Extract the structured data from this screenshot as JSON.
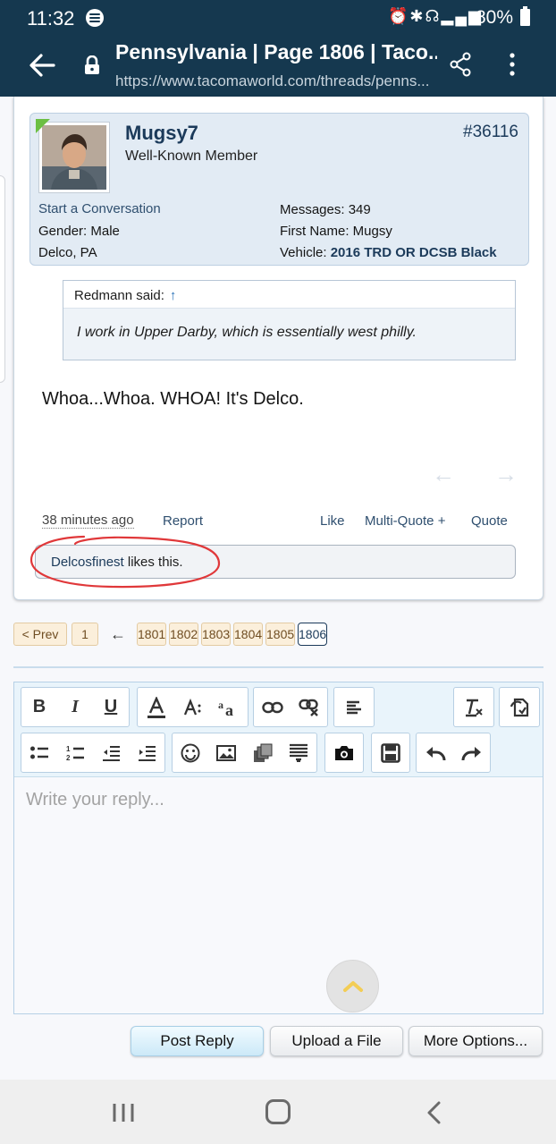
{
  "status_bar": {
    "time": "11:32",
    "battery": "80%"
  },
  "browser": {
    "title": "Pennsylvania | Page 1806 | Taco...",
    "url": "https://www.tacomaworld.com/threads/penns..."
  },
  "post": {
    "username": "Mugsy7",
    "user_title": "Well-Known Member",
    "post_number": "#36116",
    "start_conversation": "Start a Conversation",
    "gender": "Gender:  Male",
    "location": "Delco, PA",
    "messages": "Messages:  349",
    "first_name": "First Name:  Mugsy",
    "vehicle_label": "Vehicle:  ",
    "vehicle_value": "2016 TRD OR DCSB Black",
    "quote": {
      "author": "Redmann said:",
      "arrow": "↑",
      "text": "I work in Upper Darby, which is essentially west philly."
    },
    "message": "Whoa...Whoa. WHOA! It's Delco.",
    "time_ago": "38 minutes ago",
    "actions": {
      "report": "Report",
      "like": "Like",
      "multi_quote": "Multi-Quote +",
      "quote": "Quote"
    },
    "likes": {
      "user": "Delcosfinest",
      "suffix": " likes this."
    },
    "colors": {
      "highlight_circle": "#e0383a",
      "accent": "#1b3a5a"
    }
  },
  "pagination": {
    "prev": "< Prev",
    "first": "1",
    "ellipsis_arrow": "←",
    "pages": [
      "1801",
      "1802",
      "1803",
      "1804",
      "1805"
    ],
    "current": "1806"
  },
  "editor": {
    "placeholder": "Write your reply...",
    "toolbar_row1": [
      "B",
      "I",
      "U"
    ]
  },
  "buttons": {
    "post_reply": "Post Reply",
    "upload": "Upload a File",
    "more": "More Options..."
  }
}
